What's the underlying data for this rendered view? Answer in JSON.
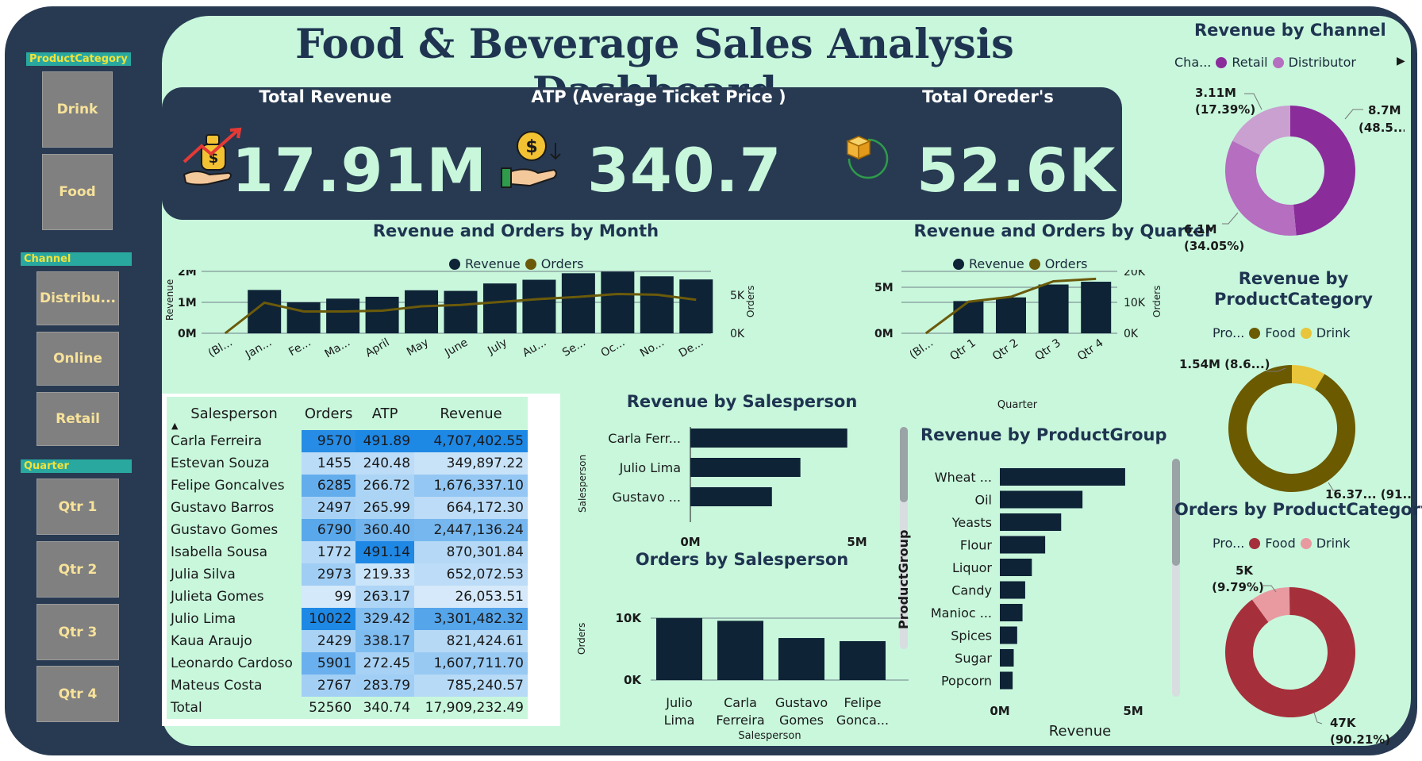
{
  "dashboard_title": "Food & Beverage Sales Analysis Dashboard",
  "colors": {
    "frame": "#283a52",
    "canvas": "#c8f7dc",
    "bar_dark": "#0e2336",
    "line_olive": "#6b5a0a",
    "retail": "#8b2c9b",
    "distributor": "#b56ec0",
    "channel_third": "#c9a0d0",
    "food_olive": "#6b5a00",
    "drink_yellow": "#e8c53a",
    "orders_food": "#a5303b",
    "orders_drink": "#e89aa0"
  },
  "slicers": {
    "product_category": {
      "title": "ProductCategory",
      "items": [
        "Drink",
        "Food"
      ]
    },
    "channel": {
      "title": "Channel",
      "items": [
        "Distribu...",
        "Online",
        "Retail"
      ]
    },
    "quarter": {
      "title": "Quarter",
      "items": [
        "Qtr 1",
        "Qtr 2",
        "Qtr 3",
        "Qtr 4"
      ]
    }
  },
  "kpis": {
    "total_revenue": {
      "label": "Total Revenue",
      "value": "17.91M",
      "icon": "money-bag-hand-icon"
    },
    "atp": {
      "label": "ATP (Average Ticket Price )",
      "value": "340.7",
      "icon": "coin-hand-icon"
    },
    "total_orders": {
      "label": "Total Oreder's",
      "value": "52.6K",
      "icon": "package-icon"
    }
  },
  "month_chart": {
    "title": "Revenue and Orders by Month",
    "legend": [
      "Revenue",
      "Orders"
    ],
    "y_ticks": [
      "2M",
      "1M",
      "0M"
    ],
    "y2_ticks": [
      "5K",
      "0K"
    ],
    "ylabel": "Revenue",
    "y2label": "Orders",
    "x_labels": [
      "(Bl...",
      "Jan...",
      "Fe...",
      "Ma...",
      "April",
      "May",
      "June",
      "July",
      "Au...",
      "Se...",
      "Oc...",
      "No...",
      "De..."
    ]
  },
  "quarter_chart": {
    "title": "Revenue and Orders by Quarter",
    "legend": [
      "Revenue",
      "Orders"
    ],
    "y_ticks": [
      "5M",
      "0M"
    ],
    "y2_ticks": [
      "20K",
      "10K",
      "0K"
    ],
    "ylabel": "Revenue",
    "y2label": "Orders",
    "xlabel": "Quarter",
    "x_labels": [
      "(Bl...",
      "Qtr 1",
      "Qtr 2",
      "Qtr 3",
      "Qtr 4"
    ]
  },
  "table": {
    "headers": [
      "Salesperson",
      "Orders",
      "ATP",
      "Revenue"
    ],
    "rows": [
      [
        "Carla Ferreira",
        "9570",
        "491.89",
        "4,707,402.55"
      ],
      [
        "Estevan Souza",
        "1455",
        "240.48",
        "349,897.22"
      ],
      [
        "Felipe Goncalves",
        "6285",
        "266.72",
        "1,676,337.10"
      ],
      [
        "Gustavo Barros",
        "2497",
        "265.99",
        "664,172.30"
      ],
      [
        "Gustavo Gomes",
        "6790",
        "360.40",
        "2,447,136.24"
      ],
      [
        "Isabella Sousa",
        "1772",
        "491.14",
        "870,301.84"
      ],
      [
        "Julia Silva",
        "2973",
        "219.33",
        "652,072.53"
      ],
      [
        "Julieta Gomes",
        "99",
        "263.17",
        "26,053.51"
      ],
      [
        "Julio Lima",
        "10022",
        "329.42",
        "3,301,482.32"
      ],
      [
        "Kaua Araujo",
        "2429",
        "338.17",
        "821,424.61"
      ],
      [
        "Leonardo Cardoso",
        "5901",
        "272.45",
        "1,607,711.70"
      ],
      [
        "Mateus Costa",
        "2767",
        "283.79",
        "785,240.57"
      ]
    ],
    "total": [
      "Total",
      "52560",
      "340.74",
      "17,909,232.49"
    ]
  },
  "rev_salesperson": {
    "title": "Revenue by Salesperson",
    "ylabel": "Salesperson",
    "labels": [
      "Carla Ferr...",
      "Julio Lima",
      "Gustavo ..."
    ],
    "x_ticks": [
      "0M",
      "5M"
    ]
  },
  "orders_salesperson": {
    "title": "Orders by Salesperson",
    "ylabel": "Orders",
    "xlabel": "Salesperson",
    "y_ticks": [
      "10K",
      "0K"
    ],
    "labels": [
      [
        "Julio",
        "Lima"
      ],
      [
        "Carla",
        "Ferreira"
      ],
      [
        "Gustavo",
        "Gomes"
      ],
      [
        "Felipe",
        "Gonca..."
      ]
    ]
  },
  "product_group": {
    "title": "Revenue by ProductGroup",
    "ylabel": "ProductGroup",
    "xlabel": "Revenue",
    "labels": [
      "Wheat ...",
      "Oil",
      "Yeasts",
      "Flour",
      "Liquor",
      "Candy",
      "Manioc ...",
      "Spices",
      "Sugar",
      "Popcorn"
    ],
    "x_ticks": [
      "0M",
      "5M"
    ]
  },
  "channel_donut": {
    "title": "Revenue by Channel",
    "legend_title": "Cha...",
    "legend": [
      "Retail",
      "Distributor"
    ],
    "label_a": [
      "8.7M",
      "(48.5...)"
    ],
    "label_b": [
      "6.1M",
      "(34.05%)"
    ],
    "label_c": [
      "3.11M",
      "(17.39%)"
    ]
  },
  "category_donut": {
    "title": [
      "Revenue by",
      "ProductCategory"
    ],
    "legend_title": "Pro...",
    "legend": [
      "Food",
      "Drink"
    ],
    "label_drink": "1.54M (8.6...)",
    "label_food": "16.37... (91...."
  },
  "orders_category_donut": {
    "title": "Orders by ProductCategory",
    "legend_title": "Pro...",
    "legend": [
      "Food",
      "Drink"
    ],
    "label_drink": [
      "5K",
      "(9.79%)"
    ],
    "label_food": [
      "47K",
      "(90.21%)"
    ]
  },
  "chart_data": [
    {
      "type": "bar",
      "title": "Revenue and Orders by Month",
      "categories": [
        "(Bl...",
        "Jan...",
        "Fe...",
        "Ma...",
        "April",
        "May",
        "June",
        "July",
        "Au...",
        "Se...",
        "Oc...",
        "No...",
        "De..."
      ],
      "series": [
        {
          "name": "Revenue",
          "values": [
            0,
            1400000,
            1000000,
            1120000,
            1180000,
            1390000,
            1370000,
            1610000,
            1730000,
            1940000,
            1990000,
            1840000,
            1740000
          ]
        },
        {
          "name": "Orders",
          "values": [
            0,
            4200,
            3000,
            3000,
            3100,
            3700,
            3900,
            4300,
            4700,
            5000,
            5400,
            5300,
            4600
          ]
        }
      ],
      "ylim": [
        0,
        2400000
      ],
      "y2lim": [
        0,
        8500
      ]
    },
    {
      "type": "bar",
      "title": "Revenue and Orders by Quarter",
      "categories": [
        "(Bl...",
        "Qtr 1",
        "Qtr 2",
        "Qtr 3",
        "Qtr 4"
      ],
      "series": [
        {
          "name": "Revenue",
          "values": [
            0,
            3500000,
            3900000,
            5300000,
            5600000
          ]
        },
        {
          "name": "Orders",
          "values": [
            0,
            10200,
            11800,
            16800,
            17600
          ]
        }
      ],
      "ylim": [
        0,
        6500000
      ],
      "y2lim": [
        0,
        20000
      ]
    },
    {
      "type": "bar",
      "title": "Revenue by Salesperson",
      "categories": [
        "Carla Ferr...",
        "Julio Lima",
        "Gustavo ..."
      ],
      "values": [
        4707402.55,
        3301482.32,
        2447136.24
      ],
      "xlim": [
        0,
        5000000
      ]
    },
    {
      "type": "bar",
      "title": "Orders by Salesperson",
      "categories": [
        "Julio Lima",
        "Carla Ferreira",
        "Gustavo Gomes",
        "Felipe Gonca..."
      ],
      "values": [
        10022,
        9570,
        6790,
        6285
      ],
      "ylim": [
        0,
        11000
      ]
    },
    {
      "type": "bar",
      "title": "Revenue by ProductGroup",
      "categories": [
        "Wheat ...",
        "Oil",
        "Yeasts",
        "Flour",
        "Liquor",
        "Candy",
        "Manioc ...",
        "Spices",
        "Sugar",
        "Popcorn"
      ],
      "values": [
        4700000,
        3100000,
        2300000,
        1700000,
        1200000,
        950000,
        850000,
        650000,
        520000,
        480000
      ],
      "xlim": [
        0,
        5000000
      ]
    },
    {
      "type": "pie",
      "title": "Revenue by Channel",
      "categories": [
        "Retail",
        "Distributor",
        "Cha..."
      ],
      "values": [
        48.5,
        34.05,
        17.39
      ]
    },
    {
      "type": "pie",
      "title": "Revenue by ProductCategory",
      "categories": [
        "Food",
        "Drink"
      ],
      "values": [
        91.4,
        8.6
      ]
    },
    {
      "type": "pie",
      "title": "Orders by ProductCategory",
      "categories": [
        "Food",
        "Drink"
      ],
      "values": [
        90.21,
        9.79
      ]
    }
  ]
}
